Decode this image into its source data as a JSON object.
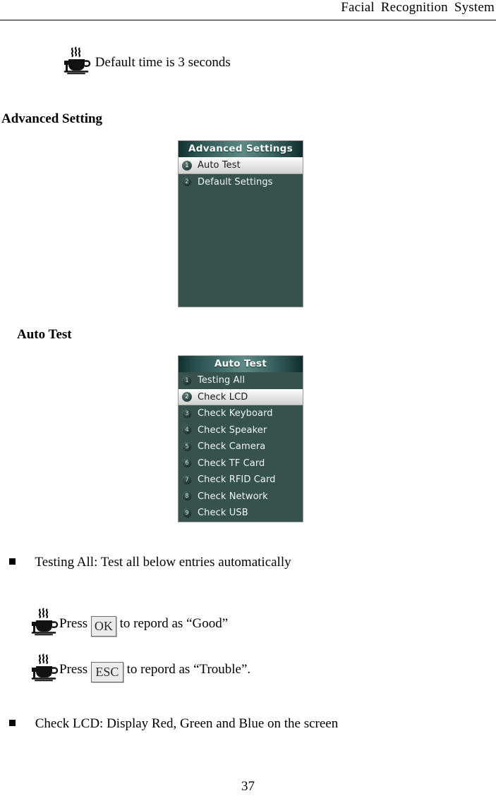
{
  "header": {
    "title": "Facial  Recognition  System"
  },
  "notes": {
    "default_time": "Default time is 3 seconds",
    "press_ok_prefix": "Press",
    "press_ok_key": "OK",
    "press_ok_suffix": "to repord as “Good”",
    "press_esc_prefix": "Press",
    "press_esc_key": "ESC",
    "press_esc_suffix": "to repord as “Trouble”."
  },
  "headings": {
    "advanced_setting": "Advanced Setting",
    "auto_test": "Auto Test"
  },
  "devices": [
    {
      "title": "Advanced Settings",
      "items": [
        {
          "number": "1",
          "label": "Auto Test",
          "selected": true
        },
        {
          "number": "2",
          "label": "Default Settings",
          "selected": false
        }
      ]
    },
    {
      "title": "Auto Test",
      "items": [
        {
          "number": "1",
          "label": "Testing All",
          "selected": false
        },
        {
          "number": "2",
          "label": "Check LCD",
          "selected": true
        },
        {
          "number": "3",
          "label": "Check Keyboard",
          "selected": false
        },
        {
          "number": "4",
          "label": "Check Speaker",
          "selected": false
        },
        {
          "number": "5",
          "label": "Check Camera",
          "selected": false
        },
        {
          "number": "6",
          "label": "Check TF Card",
          "selected": false
        },
        {
          "number": "7",
          "label": "Check RFID Card",
          "selected": false
        },
        {
          "number": "8",
          "label": "Check Network",
          "selected": false
        },
        {
          "number": "9",
          "label": "Check USB",
          "selected": false
        }
      ]
    }
  ],
  "bullets": {
    "testing_all": "Testing All: Test all below entries automatically",
    "check_lcd": "Check LCD: Display Red, Green and Blue on the screen"
  },
  "footer": {
    "page_number": "37"
  },
  "icons": {
    "coffee_cup": "coffee-cup-icon",
    "bullet": "square-bullet-icon"
  },
  "colors": {
    "device_background": "#36524F",
    "title_bar_light": "#5d8a84",
    "title_bar_dark": "#0d2b2a",
    "selected_row": "#e3e3e3"
  }
}
